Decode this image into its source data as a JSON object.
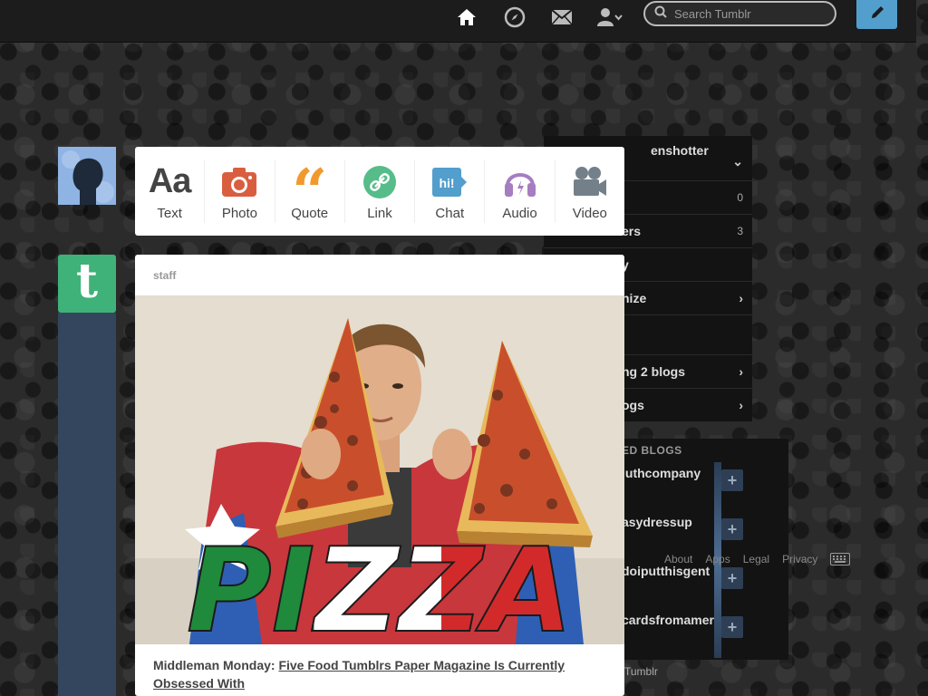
{
  "topbar": {
    "search_placeholder": "Search Tumblr",
    "icons": [
      "home-icon",
      "explore-icon",
      "inbox-icon",
      "account-icon",
      "search-icon",
      "compose-icon"
    ],
    "colors": {
      "bar": "#1c1c1c",
      "compose": "#529ecc"
    }
  },
  "post_types": [
    {
      "label": "Text",
      "icon": "text-icon",
      "color": "#444444"
    },
    {
      "label": "Photo",
      "icon": "photo-icon",
      "color": "#d95e40"
    },
    {
      "label": "Quote",
      "icon": "quote-icon",
      "color": "#f2992e"
    },
    {
      "label": "Link",
      "icon": "link-icon",
      "color": "#56bc8a"
    },
    {
      "label": "Chat",
      "icon": "chat-icon",
      "color": "#529ecc"
    },
    {
      "label": "Audio",
      "icon": "audio-icon",
      "color": "#a77dc2"
    },
    {
      "label": "Video",
      "icon": "video-icon",
      "color": "#748089"
    }
  ],
  "sidebar": {
    "blog_name": "enshotter",
    "rows": [
      {
        "label": "",
        "count": "0"
      },
      {
        "label": "ers",
        "count": "3"
      },
      {
        "label": "y",
        "count": ""
      },
      {
        "label": "nize",
        "count": ""
      }
    ],
    "following": [
      {
        "label": "ng 2 blogs"
      },
      {
        "label": "ogs"
      }
    ]
  },
  "recommended": {
    "title": "ED BLOGS",
    "items": [
      "luthcompany",
      "asydressup",
      "doiputthisgent",
      "cardsfromamer"
    ]
  },
  "footer": {
    "links": [
      "About",
      "Apps",
      "Legal",
      "Privacy"
    ],
    "brand": "Tumblr"
  },
  "post": {
    "author": "staff",
    "image_text": "PIZZA",
    "caption_prefix": "Middleman Monday:",
    "caption_link": "Five Food Tumblrs Paper Magazine Is Currently Obsessed With"
  }
}
